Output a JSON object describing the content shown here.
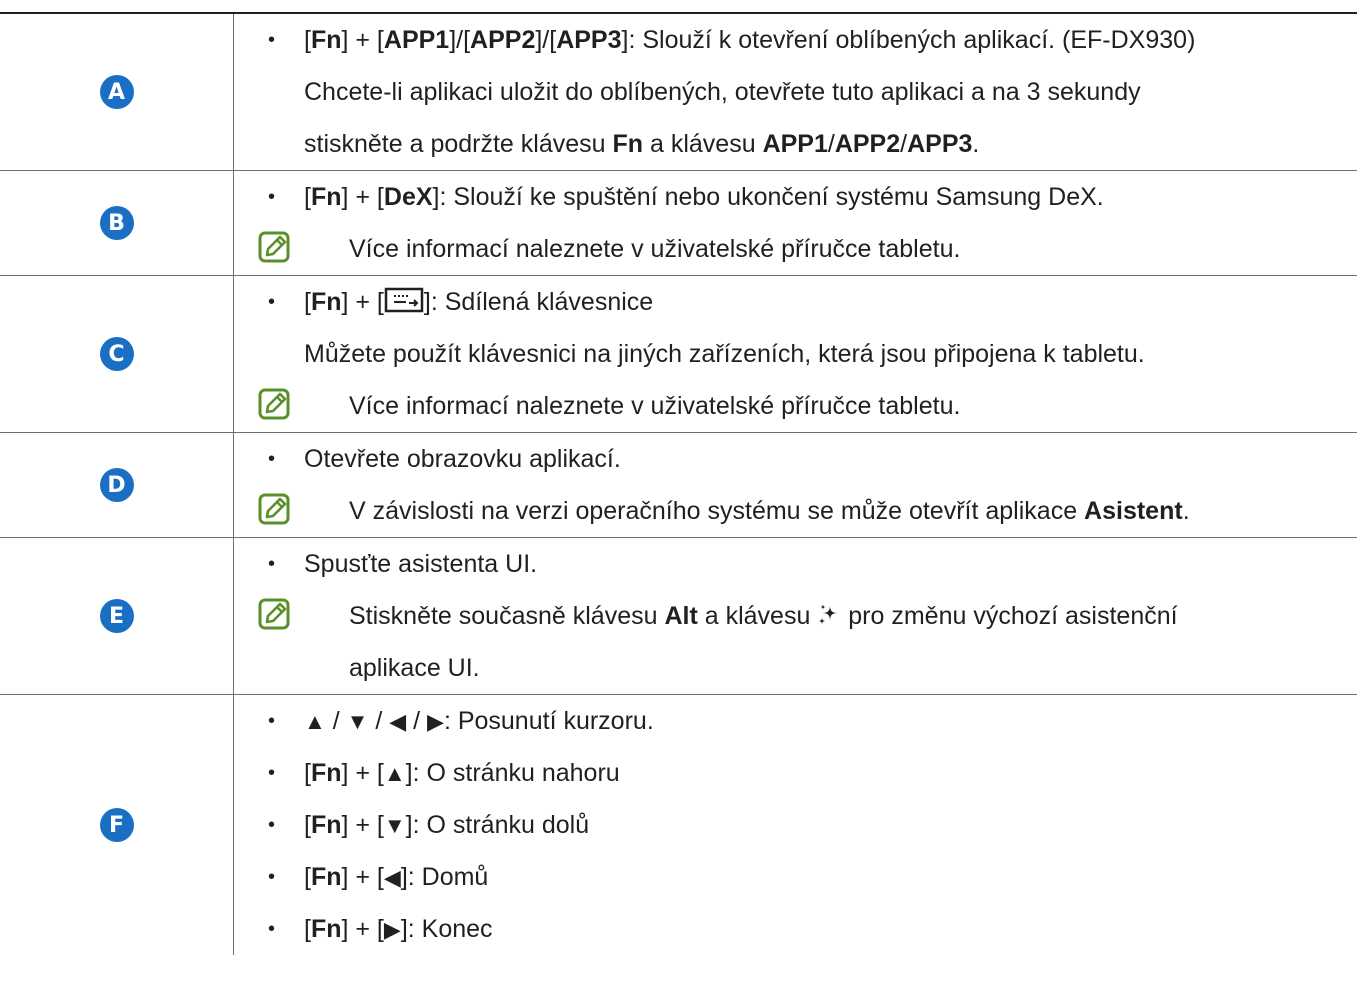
{
  "rows": [
    {
      "badge": "A",
      "lines": [
        {
          "type": "bullet",
          "parts": [
            {
              "t": "["
            },
            {
              "t": "Fn",
              "b": true
            },
            {
              "t": "] + ["
            },
            {
              "t": "APP1",
              "b": true
            },
            {
              "t": "]/["
            },
            {
              "t": "APP2",
              "b": true
            },
            {
              "t": "]/["
            },
            {
              "t": "APP3",
              "b": true
            },
            {
              "t": "]: Slouží k otevření oblíbených aplikací. (EF-DX930)"
            }
          ]
        },
        {
          "type": "indent",
          "parts": [
            {
              "t": "Chcete-li aplikaci uložit do oblíbených, otevřete tuto aplikaci a na 3 sekundy"
            }
          ]
        },
        {
          "type": "indent",
          "parts": [
            {
              "t": "stiskněte a podržte klávesu "
            },
            {
              "t": "Fn",
              "b": true
            },
            {
              "t": " a klávesu "
            },
            {
              "t": "APP1",
              "b": true
            },
            {
              "t": "/"
            },
            {
              "t": "APP2",
              "b": true
            },
            {
              "t": "/"
            },
            {
              "t": "APP3",
              "b": true
            },
            {
              "t": "."
            }
          ]
        }
      ]
    },
    {
      "badge": "B",
      "lines": [
        {
          "type": "bullet",
          "parts": [
            {
              "t": "["
            },
            {
              "t": "Fn",
              "b": true
            },
            {
              "t": "] + ["
            },
            {
              "t": "DeX",
              "b": true
            },
            {
              "t": "]: Slouží ke spuštění nebo ukončení systému Samsung DeX."
            }
          ]
        },
        {
          "type": "note",
          "parts": [
            {
              "t": "Více informací naleznete v uživatelské příručce tabletu."
            }
          ]
        }
      ]
    },
    {
      "badge": "C",
      "lines": [
        {
          "type": "bullet",
          "parts": [
            {
              "t": "["
            },
            {
              "t": "Fn",
              "b": true
            },
            {
              "t": "] + ["
            },
            {
              "icon": "shared-keyboard-icon"
            },
            {
              "t": "]: Sdílená klávesnice"
            }
          ]
        },
        {
          "type": "indent",
          "parts": [
            {
              "t": "Můžete použít klávesnici na jiných zařízeních, která jsou připojena k tabletu."
            }
          ]
        },
        {
          "type": "note",
          "parts": [
            {
              "t": "Více informací naleznete v uživatelské příručce tabletu."
            }
          ]
        }
      ]
    },
    {
      "badge": "D",
      "lines": [
        {
          "type": "bullet",
          "parts": [
            {
              "t": "Otevřete obrazovku aplikací."
            }
          ]
        },
        {
          "type": "note",
          "parts": [
            {
              "t": "V závislosti na verzi operačního systému se může otevřít aplikace "
            },
            {
              "t": "Asistent",
              "b": true
            },
            {
              "t": "."
            }
          ]
        }
      ]
    },
    {
      "badge": "E",
      "lines": [
        {
          "type": "bullet",
          "parts": [
            {
              "t": "Spusťte asistenta UI."
            }
          ]
        },
        {
          "type": "note",
          "parts": [
            {
              "t": "Stiskněte současně klávesu "
            },
            {
              "t": "Alt",
              "b": true
            },
            {
              "t": " a klávesu "
            },
            {
              "icon": "ai-sparkle-icon"
            },
            {
              "t": " pro změnu výchozí asistenční"
            }
          ]
        },
        {
          "type": "note-cont",
          "parts": [
            {
              "t": "aplikace UI."
            }
          ]
        }
      ]
    },
    {
      "badge": "F",
      "lines": [
        {
          "type": "bullet",
          "parts": [
            {
              "t": "▲",
              "tri": true
            },
            {
              "t": " / "
            },
            {
              "t": "▼",
              "tri": true
            },
            {
              "t": " / "
            },
            {
              "t": "◀",
              "tri": true
            },
            {
              "t": " / "
            },
            {
              "t": "▶",
              "tri": true
            },
            {
              "t": ": Posunutí kurzoru."
            }
          ]
        },
        {
          "type": "bullet",
          "parts": [
            {
              "t": "["
            },
            {
              "t": "Fn",
              "b": true
            },
            {
              "t": "] + ["
            },
            {
              "t": "▲",
              "tri": true
            },
            {
              "t": "]: O stránku nahoru"
            }
          ]
        },
        {
          "type": "bullet",
          "parts": [
            {
              "t": "["
            },
            {
              "t": "Fn",
              "b": true
            },
            {
              "t": "] + ["
            },
            {
              "t": "▼",
              "tri": true
            },
            {
              "t": "]: O stránku dolů"
            }
          ]
        },
        {
          "type": "bullet",
          "parts": [
            {
              "t": "["
            },
            {
              "t": "Fn",
              "b": true
            },
            {
              "t": "] + ["
            },
            {
              "t": "◀",
              "tri": true
            },
            {
              "t": "]: Domů"
            }
          ]
        },
        {
          "type": "bullet",
          "parts": [
            {
              "t": "["
            },
            {
              "t": "Fn",
              "b": true
            },
            {
              "t": "] + ["
            },
            {
              "t": "▶",
              "tri": true
            },
            {
              "t": "]: Konec"
            }
          ]
        }
      ]
    }
  ],
  "colors": {
    "badge": "#1a6fc4",
    "note_icon": "#5a8f29",
    "text": "#231f20"
  }
}
